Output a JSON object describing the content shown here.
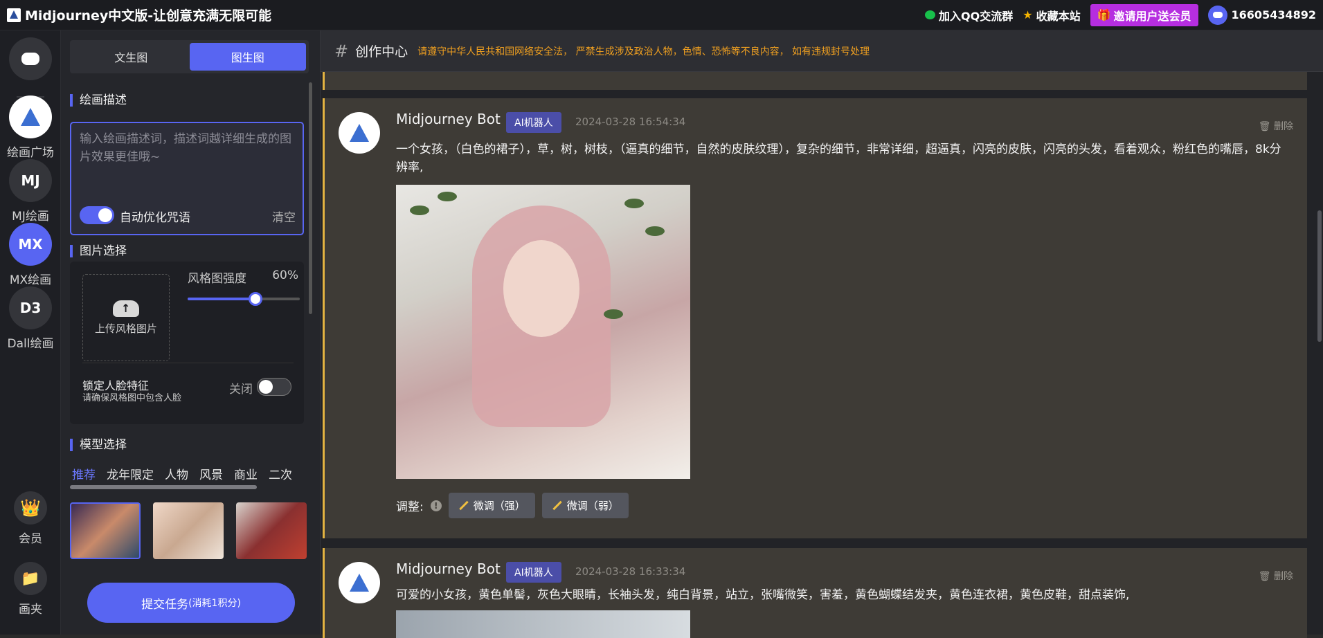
{
  "app": {
    "title": "Midjourney中文版-让创意充满无限可能",
    "links": {
      "qq": "加入QQ交流群",
      "favorite": "收藏本站",
      "invite": "邀请用户送会员"
    },
    "user": "16605434892"
  },
  "nav": {
    "items": [
      {
        "label": "绘画广场",
        "icon": "sailboat-logo-icon"
      },
      {
        "label": "MJ绘画",
        "abbr": "MJ"
      },
      {
        "label": "MX绘画",
        "abbr": "MX"
      },
      {
        "label": "Dall绘画",
        "abbr": "D3"
      },
      {
        "label": "会员",
        "icon": "crown-icon"
      },
      {
        "label": "画夹",
        "icon": "folder-icon"
      }
    ]
  },
  "panel": {
    "tabs": [
      "文生图",
      "图生图"
    ],
    "active_tab": "图生图",
    "desc_title": "绘画描述",
    "desc_placeholder": "输入绘画描述词，描述词越详细生成的图片效果更佳哦~",
    "auto_opt": "自动优化咒语",
    "auto_opt_on": true,
    "clear": "清空",
    "image_title": "图片选择",
    "upload": "上传风格图片",
    "style_strength_label": "风格图强度",
    "style_strength": "60%",
    "style_strength_value": 0.6,
    "lock_face": "锁定人脸特征",
    "lock_face_hint": "请确保风格图中包含人脸",
    "lock_face_state": "关闭",
    "model_title": "模型选择",
    "model_tabs": [
      "推荐",
      "龙年限定",
      "人物",
      "风景",
      "商业",
      "二次"
    ],
    "submit": "提交任务",
    "submit_cost": "(消耗1积分)"
  },
  "main": {
    "title": "创作中心",
    "notice": "请遵守中华人民共和国网络安全法， 严禁生成涉及政治人物，色情、恐怖等不良内容， 如有违规封号处理",
    "cards": [
      {
        "bot": "Midjourney Bot",
        "badge": "AI机器人",
        "time": "2024-03-28 16:54:34",
        "delete": "删除",
        "prompt": "一个女孩，（白色的裙子），草，树，树枝，（逼真的细节，自然的皮肤纹理），复杂的细节，非常详细，超逼真，闪亮的皮肤，闪亮的头发，看着观众，粉红色的嘴唇，8k分辨率,",
        "adjust_label": "调整:",
        "btn_strong": "微调（强）",
        "btn_weak": "微调（弱）"
      },
      {
        "bot": "Midjourney Bot",
        "badge": "AI机器人",
        "time": "2024-03-28 16:33:34",
        "delete": "删除",
        "prompt": "可爱的小女孩，黄色单髻，灰色大眼睛，长袖头发，纯白背景，站立，张嘴微笑，害羞，黄色蝴蝶结发夹，黄色连衣裙，黄色皮鞋，甜点装饰,"
      }
    ]
  }
}
